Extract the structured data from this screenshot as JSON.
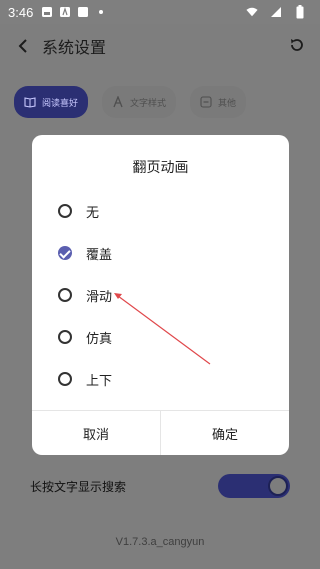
{
  "status_bar": {
    "time": "3:46",
    "icons": [
      "image-icon",
      "text-icon",
      "square-icon",
      "dot-icon"
    ],
    "right_icons": [
      "wifi-icon",
      "signal-icon",
      "battery-icon"
    ]
  },
  "header": {
    "title": "系统设置"
  },
  "tabs": [
    {
      "label": "阅读喜好",
      "icon": "book-icon",
      "active": true
    },
    {
      "label": "文字样式",
      "icon": "text-style-icon",
      "active": false
    },
    {
      "label": "其他",
      "icon": "other-icon",
      "active": false
    }
  ],
  "background_settings": {
    "long_press_search_label": "长按文字显示搜索",
    "long_press_search_enabled": true
  },
  "version": "V1.7.3.a_cangyun",
  "dialog": {
    "title": "翻页动画",
    "options": [
      {
        "label": "无",
        "selected": false
      },
      {
        "label": "覆盖",
        "selected": true
      },
      {
        "label": "滑动",
        "selected": false
      },
      {
        "label": "仿真",
        "selected": false
      },
      {
        "label": "上下",
        "selected": false
      }
    ],
    "cancel": "取消",
    "confirm": "确定"
  },
  "colors": {
    "accent": "#5b5fb0",
    "annotation": "#e0484b",
    "scrim": "#7f7f7f"
  }
}
